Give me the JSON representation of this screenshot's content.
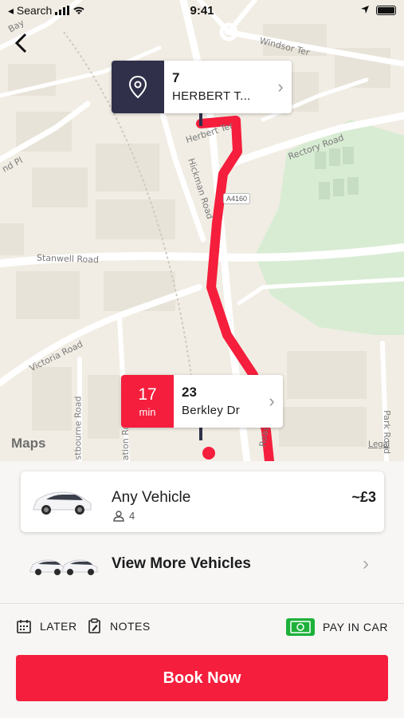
{
  "status_bar": {
    "back_app": "◂ Search",
    "time": "9:41"
  },
  "map": {
    "streets": {
      "windsor": "Windsor Ter",
      "herbert": "Herbert Ter",
      "rectory": "Rectory Road",
      "hickman": "Hickman Road",
      "stanwell": "Stanwell Road",
      "victoria": "Victoria Road",
      "eastbourne": "stbourne Road",
      "station": "ation Ro",
      "park": "Park Road",
      "pl": "nd Pl",
      "bay": "Bay",
      "road_fragment": "Road"
    },
    "road_badge": "A4160",
    "maps_logo": "Maps",
    "legal": "Legal",
    "route_color": "#f51e3c"
  },
  "pickup": {
    "number": "7",
    "street": "HERBERT T...",
    "icon": "location-pin-icon",
    "color": "#30304a"
  },
  "dropoff": {
    "eta_value": "17",
    "eta_unit": "min",
    "number": "23",
    "street": "Berkley Dr",
    "color": "#f51e3c"
  },
  "vehicle": {
    "name": "Any Vehicle",
    "seats": "4",
    "price": "~£3"
  },
  "more_vehicles": {
    "label": "View More Vehicles"
  },
  "options": {
    "later": "LATER",
    "notes": "NOTES",
    "pay": "PAY IN CAR",
    "pay_color": "#1db13b"
  },
  "book": {
    "label": "Book Now",
    "color": "#f51e3c"
  }
}
